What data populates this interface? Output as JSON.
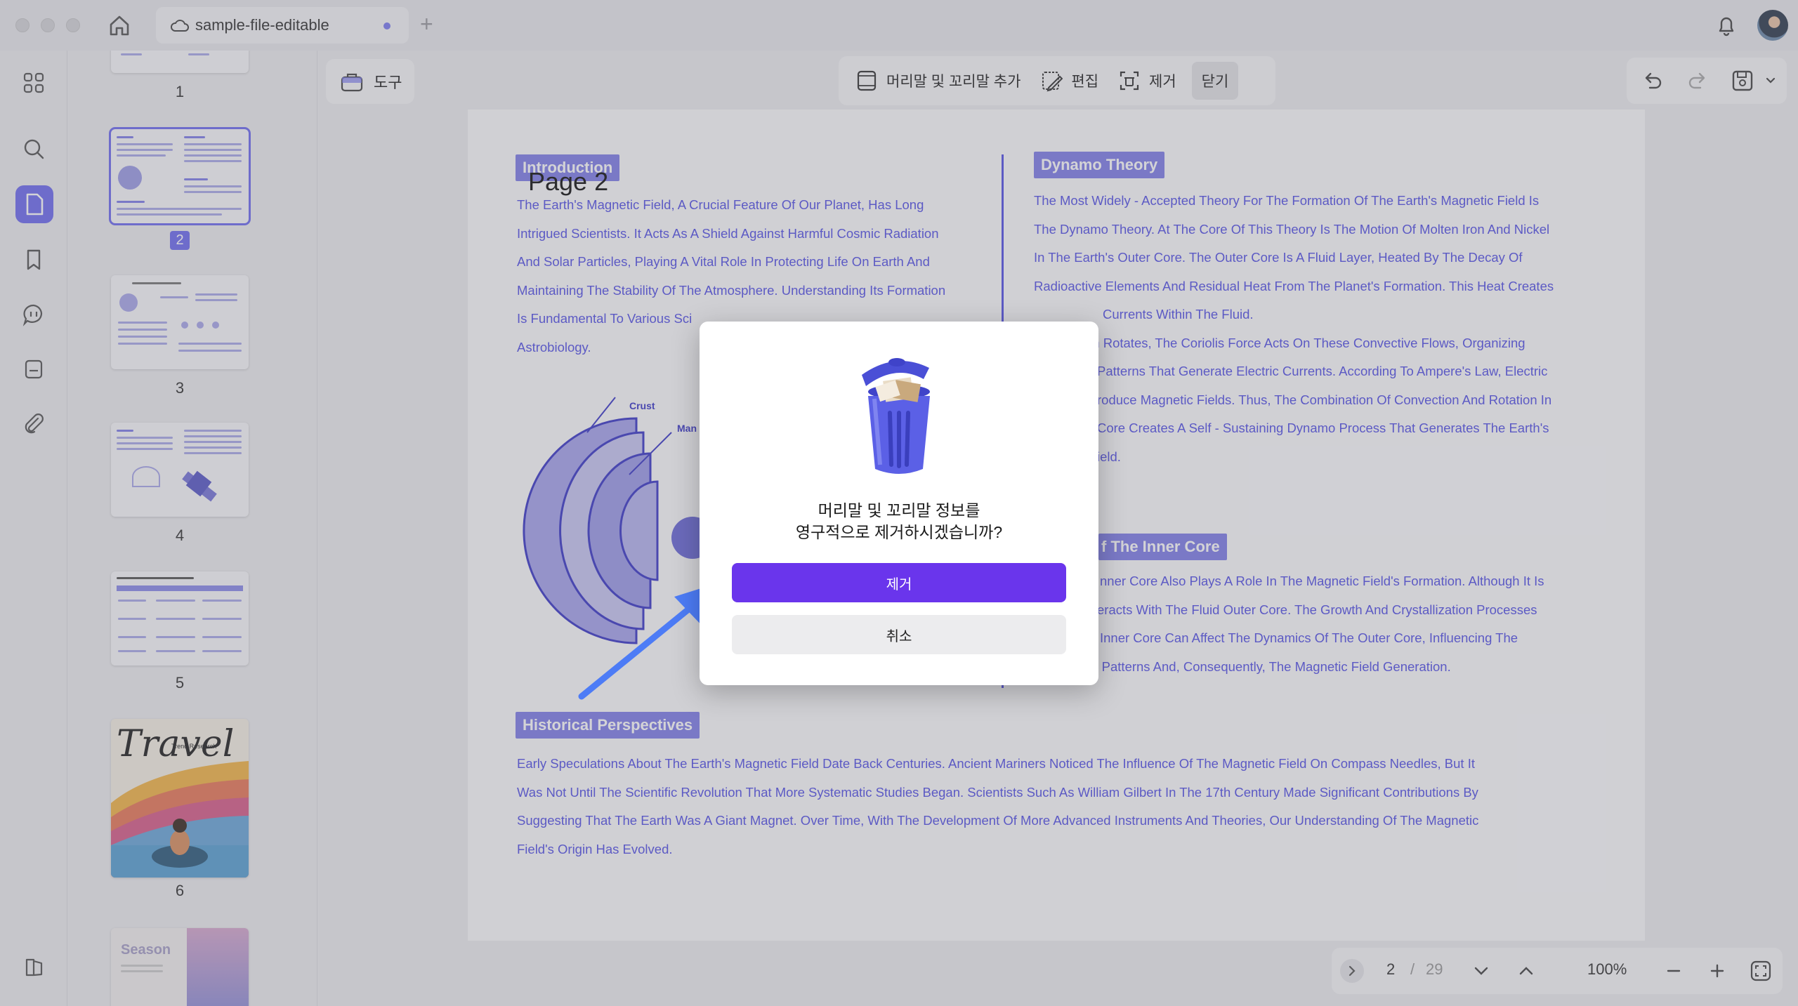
{
  "window": {
    "tab_title": "sample-file-editable",
    "new_tab": "+"
  },
  "toolbar": {
    "tools_label": "도구",
    "add_header_footer": "머리말 및 꼬리말 추가",
    "edit": "편집",
    "remove": "제거",
    "close": "닫기"
  },
  "thumbnails": {
    "pages": [
      "1",
      "2",
      "3",
      "4",
      "5",
      "6"
    ],
    "selected": "2",
    "travel_title": "Travel",
    "travel_sub": "Trend Research",
    "season_title": "Season"
  },
  "document": {
    "page_label": "Page 2",
    "intro_heading": "Introduction",
    "intro_lines": [
      "The Earth's Magnetic Field, A Crucial Feature Of Our Planet, Has Long",
      "Intrigued Scientists. It Acts As A Shield Against Harmful Cosmic Radiation",
      "And Solar Particles, Playing A Vital Role In Protecting Life On Earth And",
      "Maintaining The Stability Of The Atmosphere. Understanding Its Formation",
      "Is Fundamental To Various Sci",
      "Astrobiology."
    ],
    "crust_label": "Crust",
    "mantle_label": "Man",
    "dynamo_heading": "Dynamo Theory",
    "dynamo_lines": [
      "The Most Widely - Accepted Theory For The Formation Of The Earth's Magnetic Field Is",
      "The Dynamo Theory. At The Core Of This Theory Is The Motion Of Molten Iron And Nickel",
      "In The Earth's Outer Core. The Outer Core Is A Fluid Layer, Heated By The Decay Of",
      "Radioactive Elements And Residual Heat From The Planet's Formation. This Heat Creates",
      "Currents Within The Fluid.",
      "rth Rotates, The Coriolis Force Acts On These Convective Flows, Organizing",
      "Patterns That Generate Electric Currents. According To Ampere's Law, Electric",
      "roduce Magnetic Fields. Thus, The Combination Of Convection And Rotation In",
      "Core Creates A Self - Sustaining Dynamo Process That Generates The Earth's",
      "ield."
    ],
    "inner_core_heading": "f The Inner Core",
    "inner_core_lines": [
      "nner Core Also Plays A Role In The Magnetic Field's Formation. Although It Is",
      "eracts With The Fluid Outer Core. The Growth And Crystallization Processes",
      "Inner Core Can Affect The Dynamics Of The Outer Core, Influencing The",
      "Convective Patterns And, Consequently, The Magnetic Field Generation."
    ],
    "history_heading": "Historical Perspectives",
    "history_lines": [
      "Early Speculations About The Earth's Magnetic Field Date Back Centuries. Ancient Mariners Noticed The Influence Of The Magnetic Field On Compass Needles, But It",
      "Was Not Until The Scientific Revolution That More Systematic Studies Began. Scientists Such As William Gilbert In The 17th Century Made Significant Contributions By",
      "Suggesting That The Earth Was A Giant Magnet. Over Time, With The Development Of More Advanced Instruments And Theories, Our Understanding Of The Magnetic",
      "Field's Origin Has Evolved."
    ]
  },
  "dialog": {
    "message_line1": "머리말 및 꼬리말 정보를",
    "message_line2": "영구적으로 제거하시겠습니까?",
    "confirm": "제거",
    "cancel": "취소"
  },
  "pager": {
    "current": "2",
    "separator": "/",
    "total": "29",
    "zoom": "100%"
  },
  "colors": {
    "accent": "#6f6cf0",
    "doc_blue": "#5552e6",
    "confirm": "#6a35ec"
  }
}
